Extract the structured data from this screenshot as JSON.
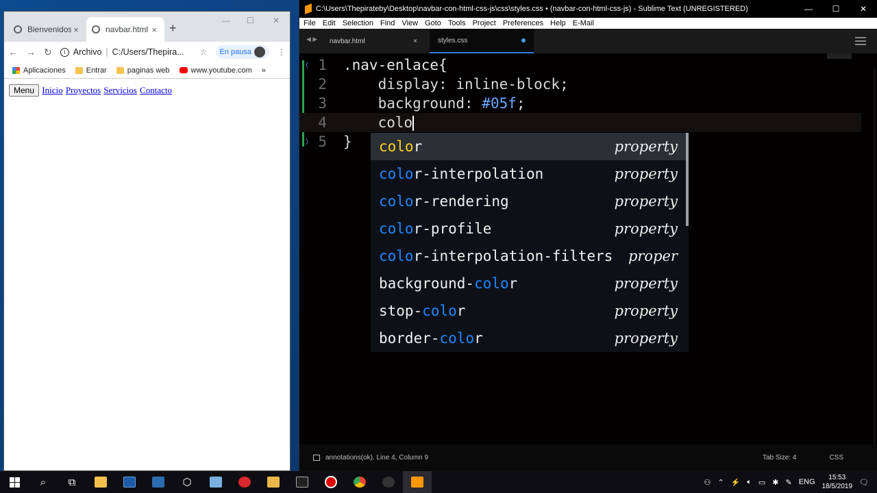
{
  "chrome": {
    "tabs": [
      {
        "title": "Bienvenidos"
      },
      {
        "title": "navbar.html"
      }
    ],
    "address": {
      "scheme": "Archivo",
      "path": "C:/Users/Thepira..."
    },
    "paused_label": "En pausa",
    "bookmarks": [
      "Aplicaciones",
      "Entrar",
      "paginas web",
      "www.youtube.com"
    ],
    "page": {
      "menu_button": "Menu",
      "links": [
        "Inicio",
        "Proyectos",
        "Servicios",
        "Contacto"
      ]
    }
  },
  "sublime": {
    "title": "C:\\Users\\Thepirateby\\Desktop\\navbar-con-html-css-js\\css\\styles.css • (navbar-con-html-css-js) - Sublime Text (UNREGISTERED)",
    "menu": [
      "File",
      "Edit",
      "Selection",
      "Find",
      "View",
      "Goto",
      "Tools",
      "Project",
      "Preferences",
      "Help",
      "E-Mail"
    ],
    "tabs": [
      {
        "name": "navbar.html",
        "close": "×"
      },
      {
        "name": "styles.css",
        "modified": true
      }
    ],
    "code": {
      "line_numbers": [
        "1",
        "2",
        "3",
        "4",
        "5"
      ],
      "l1": ".nav-enlace{",
      "l2": "    display: inline-block;",
      "l3_prefix": "    background: ",
      "l3_value": "#05f",
      "l3_suffix": ";",
      "l4": "    colo",
      "l5": "}"
    },
    "autocomplete": [
      {
        "pre": "",
        "match": "colo",
        "post": "r",
        "kind": "property"
      },
      {
        "pre": "",
        "match": "colo",
        "post": "r-interpolation",
        "kind": "property"
      },
      {
        "pre": "",
        "match": "colo",
        "post": "r-rendering",
        "kind": "property"
      },
      {
        "pre": "",
        "match": "colo",
        "post": "r-profile",
        "kind": "property"
      },
      {
        "pre": "",
        "match": "colo",
        "post": "r-interpolation-filters",
        "kind": "proper"
      },
      {
        "pre": "background-",
        "match": "colo",
        "post": "r",
        "kind": "property"
      },
      {
        "pre": "stop-",
        "match": "colo",
        "post": "r",
        "kind": "property"
      },
      {
        "pre": "border-",
        "match": "colo",
        "post": "r",
        "kind": "property"
      }
    ],
    "status": {
      "left": "annotations(ok). Line 4, Column 9",
      "tab_size": "Tab Size: 4",
      "syntax": "CSS"
    }
  },
  "taskbar": {
    "lang": "ENG",
    "time": "15:53",
    "date": "18/5/2019"
  },
  "colors": {
    "accent": "#1e88ff",
    "match_selected": "#ffd21a",
    "hex_value": "#6aa9ff"
  }
}
